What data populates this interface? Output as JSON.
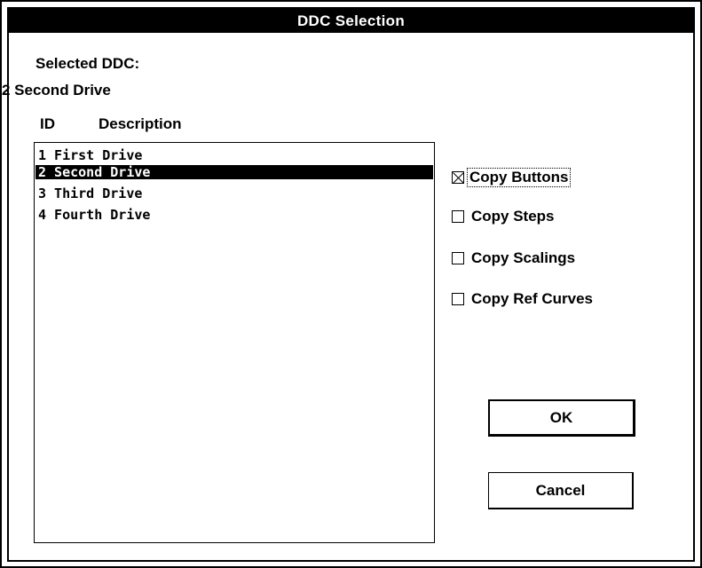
{
  "window": {
    "title": "DDC Selection"
  },
  "selection": {
    "heading": "Selected DDC:",
    "value": "2 Second Drive"
  },
  "list": {
    "headers": {
      "id": "ID",
      "description": "Description"
    },
    "items": [
      {
        "text": "1 First Drive",
        "selected": false
      },
      {
        "text": "2 Second Drive",
        "selected": true
      },
      {
        "text": "3 Third Drive",
        "selected": false
      },
      {
        "text": "4 Fourth Drive",
        "selected": false
      }
    ]
  },
  "options": {
    "copy_buttons": {
      "label": "Copy Buttons",
      "checked": true
    },
    "copy_steps": {
      "label": "Copy Steps",
      "checked": false
    },
    "copy_scalings": {
      "label": "Copy Scalings",
      "checked": false
    },
    "copy_ref_curves": {
      "label": "Copy Ref Curves",
      "checked": false
    }
  },
  "buttons": {
    "ok": "OK",
    "cancel": "Cancel"
  }
}
